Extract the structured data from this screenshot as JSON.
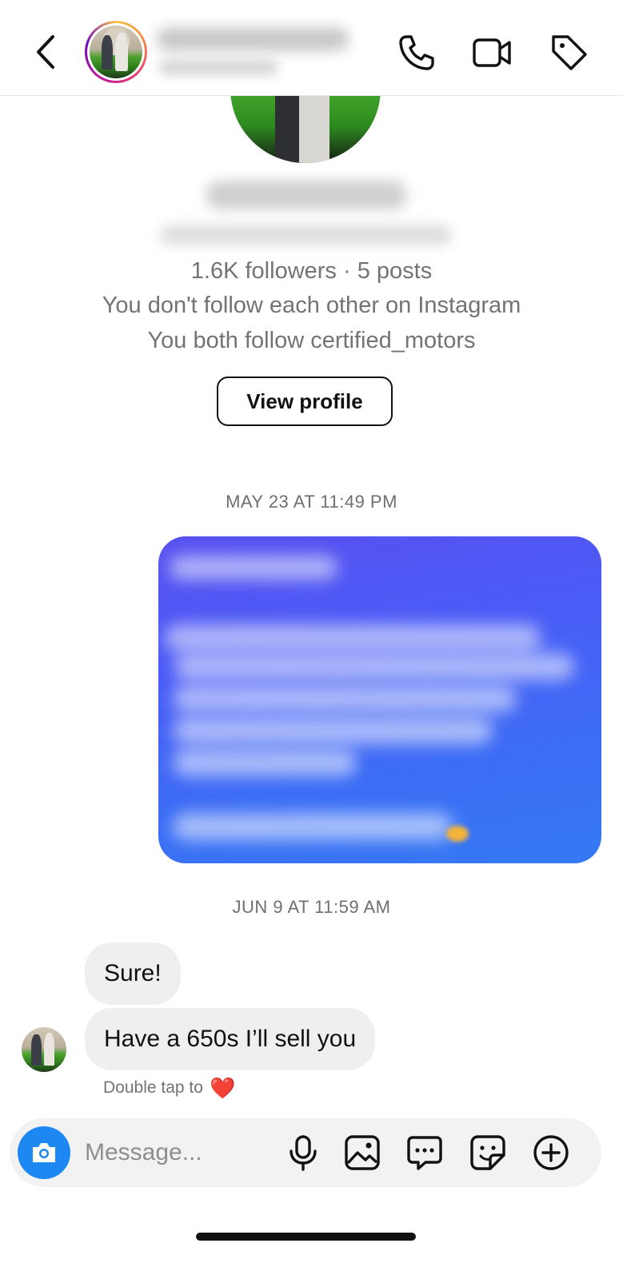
{
  "header": {
    "back_icon": "chevron-left-icon",
    "actions": [
      "phone-icon",
      "video-camera-icon",
      "tag-icon"
    ]
  },
  "profile": {
    "stats": "1.6K followers · 5 posts",
    "follow_status": "You don't follow each other on Instagram",
    "mutual": "You both follow certified_motors",
    "view_profile_label": "View profile"
  },
  "thread": {
    "timestamp_1": "MAY 23 AT 11:49 PM",
    "timestamp_2": "JUN 9 AT 11:59 AM",
    "incoming_1": "Sure!",
    "incoming_2": "Have a 650s I’ll sell you",
    "reaction_hint": "Double tap to",
    "reaction_emoji": "❤️"
  },
  "composer": {
    "placeholder": "Message...",
    "buttons": [
      "camera-icon",
      "microphone-icon",
      "gallery-icon",
      "chat-bubble-icon",
      "sticker-icon",
      "plus-icon"
    ]
  },
  "colors": {
    "accent_blue": "#1e88f2",
    "outgoing_bubble_top": "#5750f0",
    "outgoing_bubble_bottom": "#3579f4",
    "heart_red": "#e0202f"
  }
}
